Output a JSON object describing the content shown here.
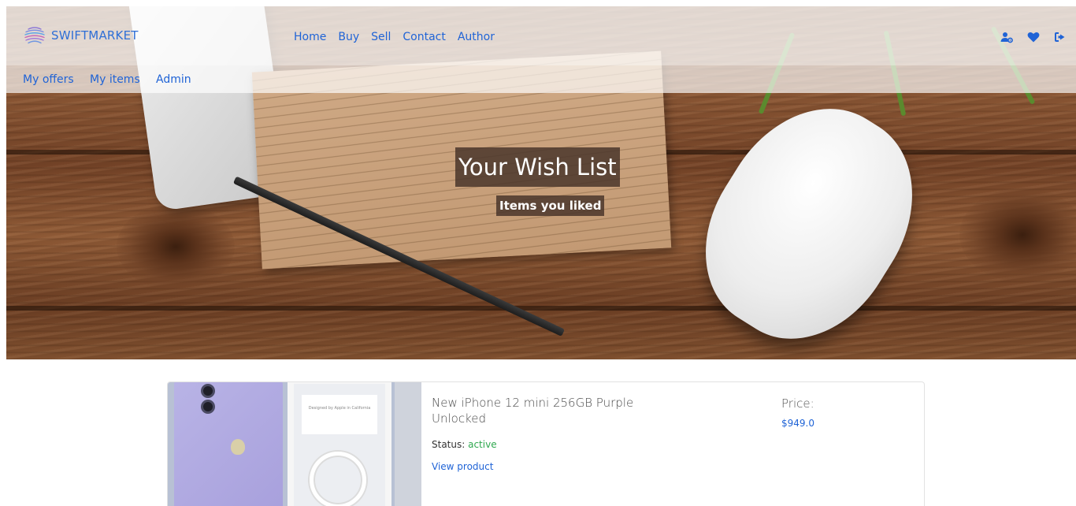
{
  "brand": {
    "name": "SWIFTMARKET",
    "logo_icon": "globe-lines-icon"
  },
  "nav": {
    "main": [
      "Home",
      "Buy",
      "Sell",
      "Contact",
      "Author"
    ],
    "sub": [
      "My offers",
      "My items",
      "Admin"
    ],
    "icons": [
      "user-cog-icon",
      "heart-icon",
      "sign-out-icon"
    ],
    "accent": "#1f63d6"
  },
  "hero": {
    "title": "Your Wish List",
    "subtitle": "Items you liked"
  },
  "wishlist": [
    {
      "title": "New iPhone 12 mini 256GB Purple Unlocked",
      "status_label": "Status:",
      "status_value": "active",
      "status_color": "#2fa84f",
      "link_label": "View product",
      "price_label": "Price:",
      "price_value": "$949.0",
      "box_text": "Designed by Apple in California"
    }
  ]
}
